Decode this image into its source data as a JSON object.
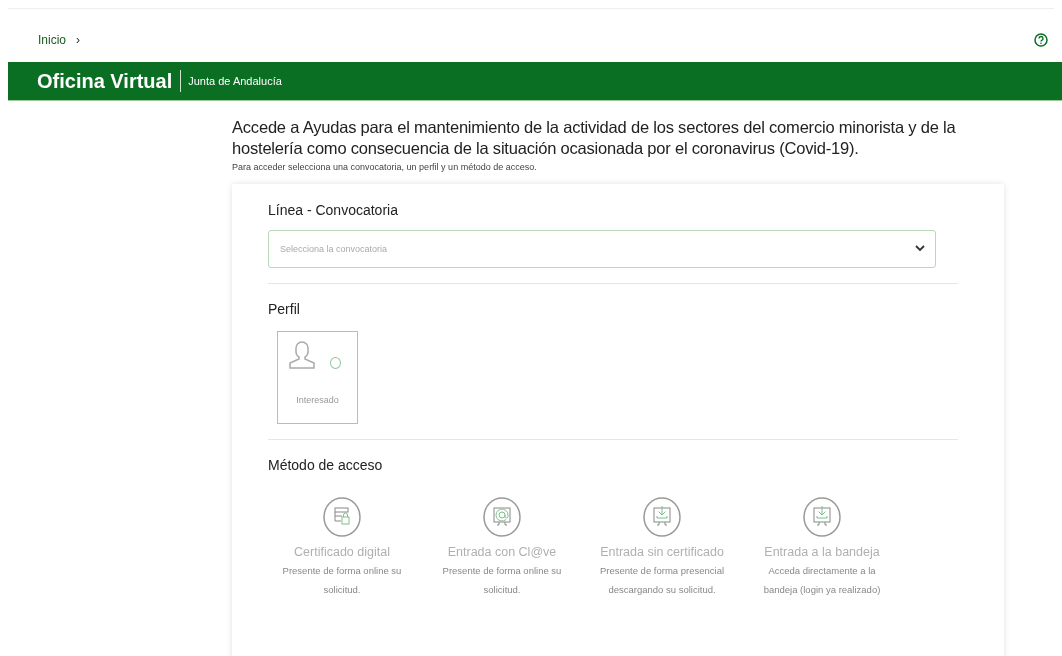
{
  "breadcrumb": [
    {
      "label": "Inicio",
      "separator": "›"
    }
  ],
  "header": {
    "title": "Oficina Virtual",
    "subtitle": "Junta de Andalucía"
  },
  "page": {
    "title": "Accede a Ayudas para el mantenimiento de la actividad de los sectores del comercio minorista y de la hostelería como consecuencia de la situación ocasionada por el coronavirus (Covid-19).",
    "subtitle": "Para acceder selecciona una convocatoria, un perfil y un método de acceso."
  },
  "convocatoria": {
    "heading": "Línea - Convocatoria",
    "placeholder": "Selecciona la convocatoria"
  },
  "perfil": {
    "heading": "Perfil",
    "options": [
      {
        "label": "Interesado",
        "selected": false
      }
    ]
  },
  "metodo": {
    "heading": "Método de acceso",
    "options": [
      {
        "kind": "certificate",
        "title": "Certificado digital",
        "description": "Presente de forma online su solicitud."
      },
      {
        "kind": "clave",
        "title": "Entrada con Cl@ve",
        "description": "Presente de forma online su solicitud."
      },
      {
        "kind": "download",
        "title": "Entrada sin certificado",
        "description": "Presente de forma presencial descargando su solicitud."
      },
      {
        "kind": "download",
        "title": "Entrada a la bandeja",
        "description": "Acceda directamente a la bandeja (login ya realizado)"
      }
    ]
  }
}
